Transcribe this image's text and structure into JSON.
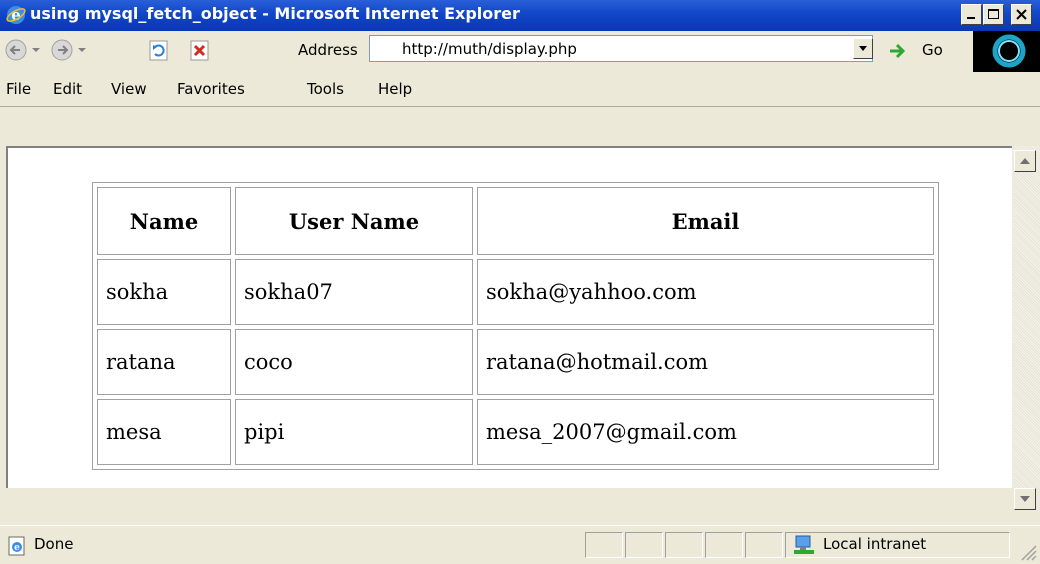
{
  "window": {
    "title": "using mysql_fetch_object - Microsoft Internet Explorer"
  },
  "toolbar": {
    "address_label": "Address",
    "url": "http://muth/display.php",
    "go_label": "Go"
  },
  "menu": [
    "File",
    "Edit",
    "View",
    "Favorites",
    "Tools",
    "Help"
  ],
  "table": {
    "headers": [
      "Name",
      "User Name",
      "Email"
    ],
    "rows": [
      [
        "sokha",
        "sokha07",
        "sokha@yahhoo.com"
      ],
      [
        "ratana",
        "coco",
        "ratana@hotmail.com"
      ],
      [
        "mesa",
        "pipi",
        "mesa_2007@gmail.com"
      ]
    ]
  },
  "status": {
    "text": "Done",
    "zone": "Local intranet"
  },
  "icons": [
    "ie-logo-icon",
    "back-icon",
    "forward-icon",
    "refresh-icon",
    "stop-icon",
    "dropdown-icon",
    "go-arrow-icon",
    "scroll-up-icon",
    "scroll-down-icon",
    "page-icon",
    "intranet-icon"
  ],
  "colors": {
    "titlebar": "#0a38b0",
    "chrome": "#ece9d8",
    "go_arrow": "#2fa82f",
    "stop": "#d42a1c"
  }
}
